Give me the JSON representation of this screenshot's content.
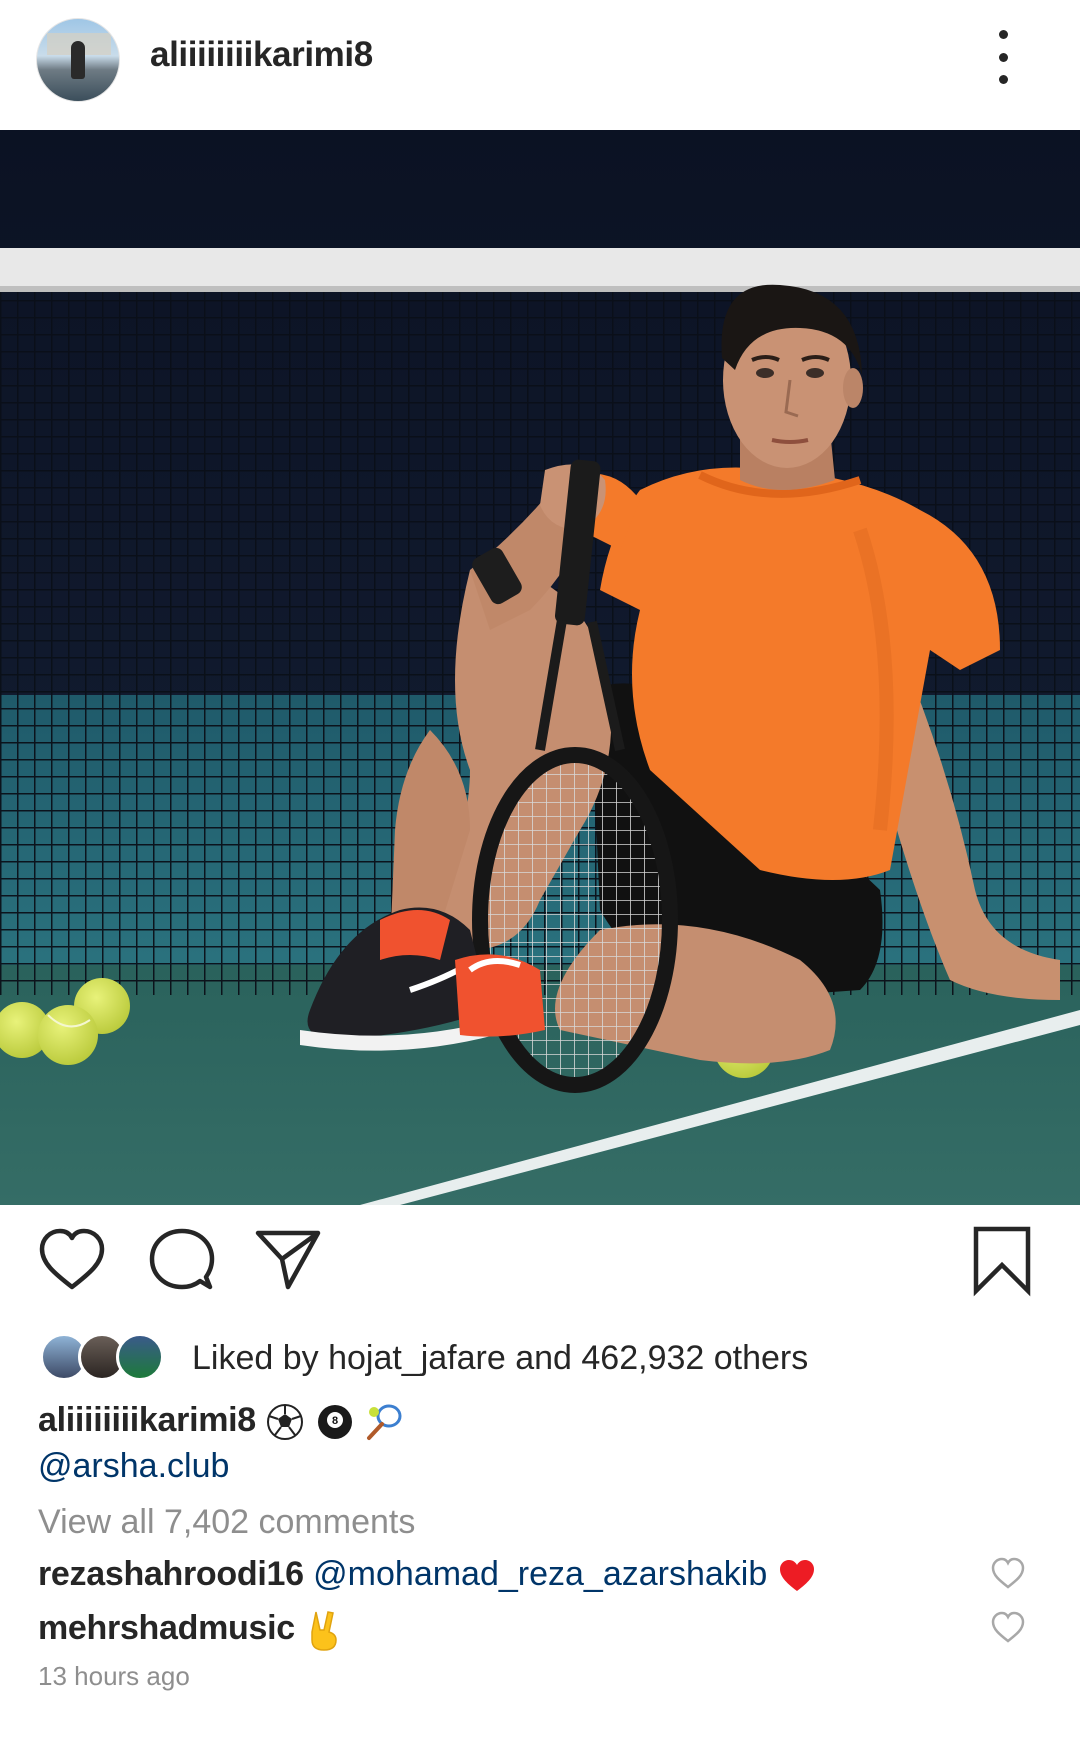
{
  "header": {
    "username": "aliiiiiiiikarimi8",
    "more_icon": "more-vertical-icon"
  },
  "photo": {
    "description_icon": "post-photo"
  },
  "actions": {
    "like_icon": "heart-icon",
    "comment_icon": "comment-bubble-icon",
    "share_icon": "paper-plane-icon",
    "save_icon": "bookmark-icon"
  },
  "likes": {
    "text": "Liked by hojat_jafare and 462,932 others"
  },
  "caption": {
    "username": "aliiiiiiiikarimi8",
    "emojis": "⚽🎱🎾",
    "mention": "@arsha.club"
  },
  "comments": {
    "view_all": "View all 7,402 comments",
    "items": [
      {
        "user": "rezashahroodi16",
        "text": "@mohamad_reza_azarshakib",
        "emoji": "❤️"
      },
      {
        "user": "mehrshadmusic",
        "text": "",
        "emoji": "✌️"
      }
    ]
  },
  "timestamp": "13 hours ago",
  "colors": {
    "text": "#262626",
    "mention": "#003569",
    "secondary": "#8e8e8e",
    "heart_red": "#ed1c24",
    "shirt_orange": "#f47a2a",
    "court_green": "#2e6b63"
  }
}
